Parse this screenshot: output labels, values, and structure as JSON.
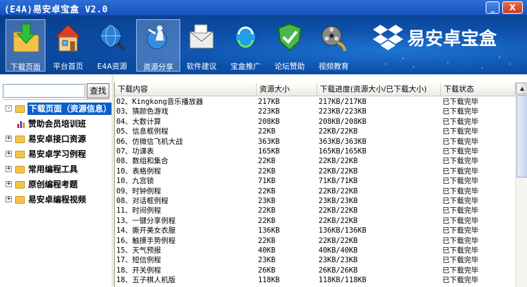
{
  "window": {
    "title": "(E4A)易安卓宝盒 V2.0",
    "minimize": "_",
    "close": "X"
  },
  "toolbar": {
    "tools": [
      {
        "label": "下载页面",
        "icon": "download-folder-icon"
      },
      {
        "label": "平台首页",
        "icon": "home-icon"
      },
      {
        "label": "E4A资源",
        "icon": "globe-magnifier-icon"
      },
      {
        "label": "资源分享",
        "icon": "share-person-icon"
      },
      {
        "label": "软件建议",
        "icon": "mail-envelope-icon"
      },
      {
        "label": "宝盒推广",
        "icon": "refresh-globe-icon"
      },
      {
        "label": "论坛赞助",
        "icon": "shield-check-icon"
      },
      {
        "label": "视频教育",
        "icon": "film-reel-icon"
      }
    ],
    "brand_name": "易安卓宝盒"
  },
  "sidebar": {
    "search_button": "查找",
    "search_value": "",
    "tree": [
      {
        "label": "下载页面（资源信息）",
        "expander": "-",
        "selected": true,
        "level": 0
      },
      {
        "label": "赞助会员培训班",
        "expander": "",
        "selected": false,
        "level": 1
      },
      {
        "label": "易安卓接口资源",
        "expander": "+",
        "selected": false,
        "level": 0
      },
      {
        "label": "易安卓学习例程",
        "expander": "+",
        "selected": false,
        "level": 0
      },
      {
        "label": "常用编程工具",
        "expander": "+",
        "selected": false,
        "level": 0
      },
      {
        "label": "原创编程考题",
        "expander": "+",
        "selected": false,
        "level": 0
      },
      {
        "label": "易安卓编程视频",
        "expander": "+",
        "selected": false,
        "level": 0
      }
    ]
  },
  "table": {
    "columns": [
      "下载内容",
      "资源大小",
      "下载进度(资源大小/已下载大小)",
      "下载状态"
    ],
    "rows": [
      [
        "02、Kingkong音乐播放器",
        "217KB",
        "217KB/217KB",
        "已下载完毕"
      ],
      [
        "03、猜颜色游戏",
        "223KB",
        "223KB/223KB",
        "已下载完毕"
      ],
      [
        "04、大数计算",
        "208KB",
        "208KB/208KB",
        "已下载完毕"
      ],
      [
        "05、信息框例程",
        "22KB",
        "22KB/22KB",
        "已下载完毕"
      ],
      [
        "06、仿微信飞机大战",
        "363KB",
        "363KB/363KB",
        "已下载完毕"
      ],
      [
        "07、功课表",
        "165KB",
        "165KB/165KB",
        "已下载完毕"
      ],
      [
        "08、数组和集合",
        "22KB",
        "22KB/22KB",
        "已下载完毕"
      ],
      [
        "10、表格例程",
        "22KB",
        "22KB/22KB",
        "已下载完毕"
      ],
      [
        "10、九宫锁",
        "71KB",
        "71KB/71KB",
        "已下载完毕"
      ],
      [
        "09、时钟例程",
        "22KB",
        "22KB/22KB",
        "已下载完毕"
      ],
      [
        "08、对话框例程",
        "23KB",
        "23KB/23KB",
        "已下载完毕"
      ],
      [
        "11、时间例程",
        "22KB",
        "22KB/22KB",
        "已下载完毕"
      ],
      [
        "13、一键分享例程",
        "22KB",
        "22KB/22KB",
        "已下载完毕"
      ],
      [
        "14、撕开美女衣服",
        "136KB",
        "136KB/136KB",
        "已下载完毕"
      ],
      [
        "16、触摸手势例程",
        "22KB",
        "22KB/22KB",
        "已下载完毕"
      ],
      [
        "15、天气预报",
        "40KB",
        "40KB/40KB",
        "已下载完毕"
      ],
      [
        "17、短信例程",
        "23KB",
        "23KB/23KB",
        "已下载完毕"
      ],
      [
        "18、开关例程",
        "26KB",
        "26KB/26KB",
        "已下载完毕"
      ],
      [
        "18、五子棋人机版",
        "118KB",
        "118KB/118KB",
        "已下载完毕"
      ]
    ]
  },
  "colors": {
    "title_bar": "#1553c0",
    "toolbar_bg": "#0d4fa8",
    "selection": "#0a5fc8"
  }
}
